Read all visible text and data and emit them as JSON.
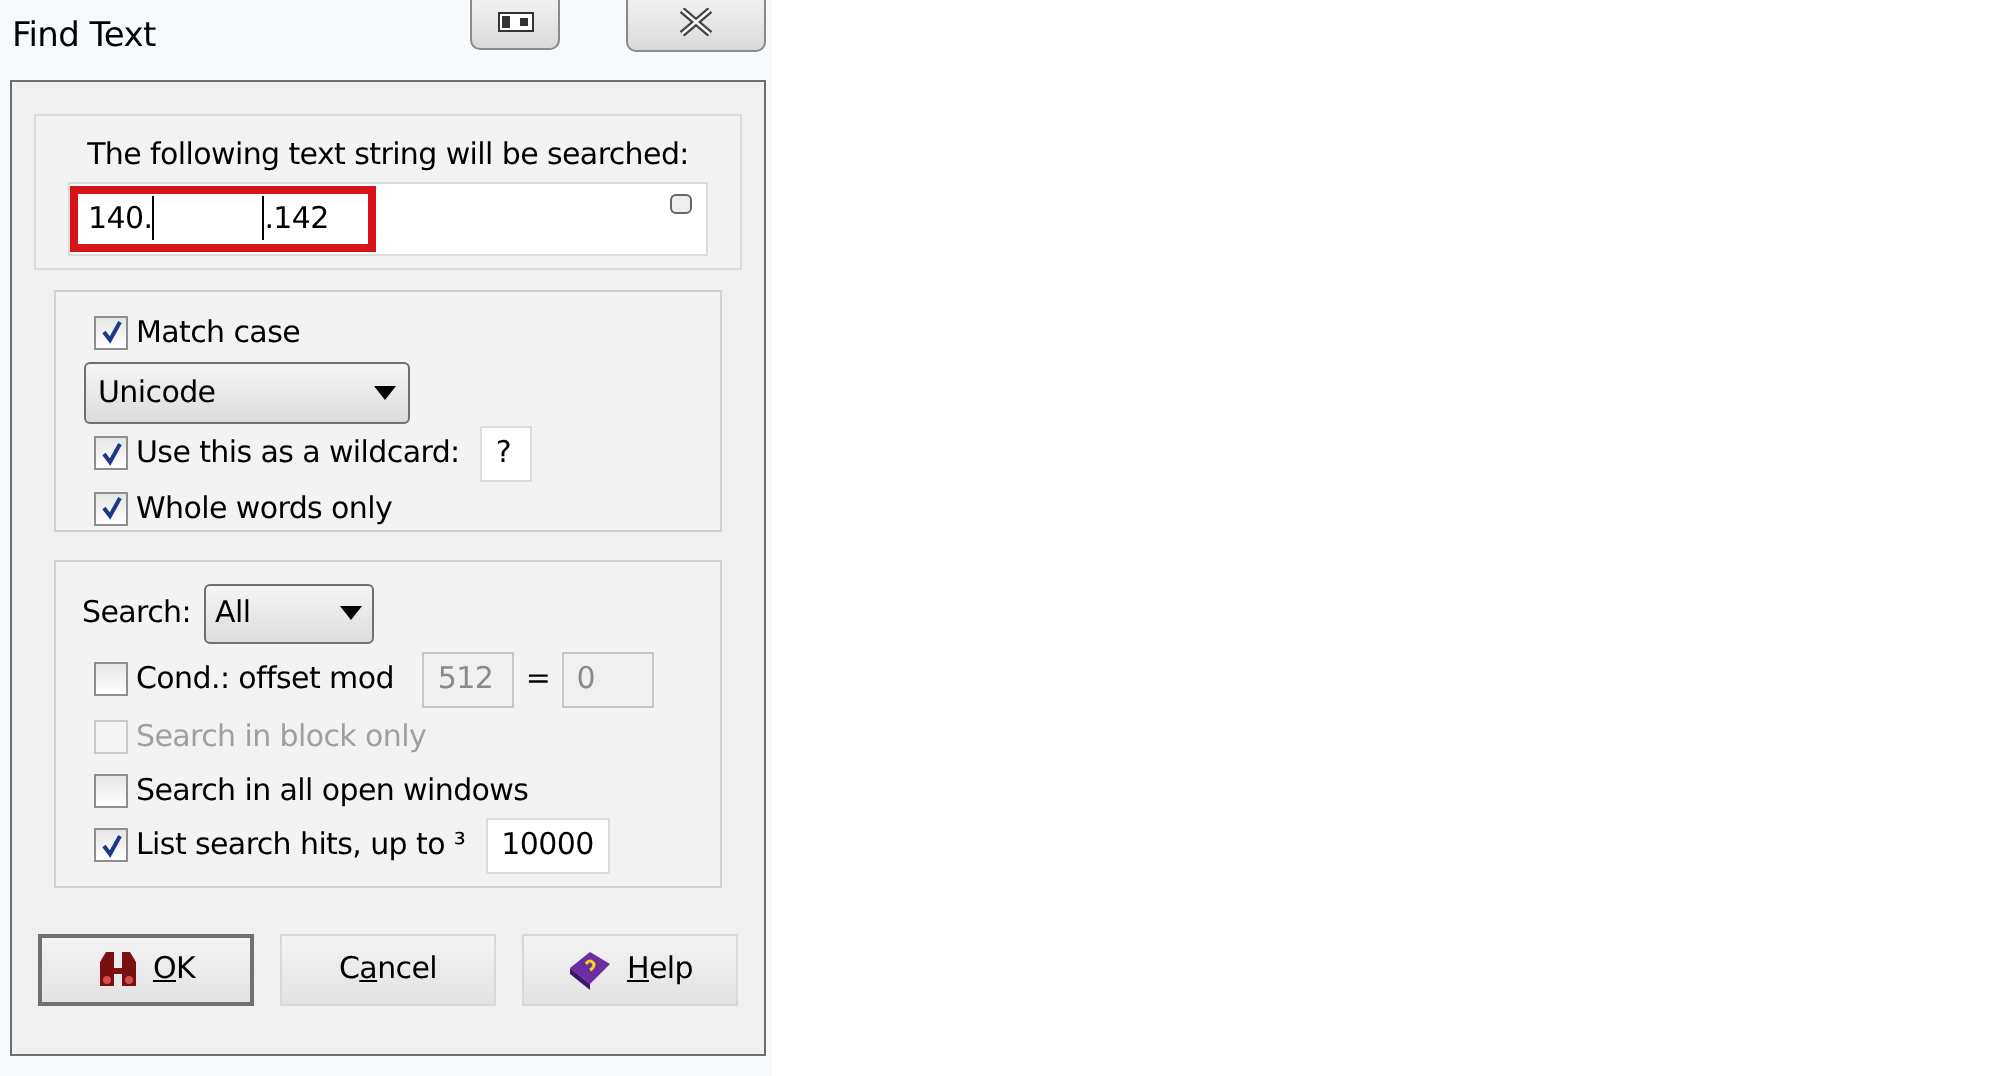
{
  "window": {
    "title": "Find Text"
  },
  "search_string": {
    "label": "The following text string will be searched:",
    "value_start": "140.",
    "value_end": ".142",
    "redacted": true,
    "highlighted": true
  },
  "options": [
    {
      "kind": "checkbox",
      "label": "Match case",
      "checked": true,
      "disabled": false
    },
    {
      "kind": "dropdown",
      "value": "Unicode"
    },
    {
      "kind": "checkbox_field",
      "label": "Use this as a wildcard:",
      "checked": true,
      "disabled": false,
      "value": "?"
    },
    {
      "kind": "checkbox",
      "label": "Whole words only",
      "checked": true,
      "disabled": false
    }
  ],
  "search_options": [
    {
      "kind": "labeled_dropdown",
      "label": "Search:",
      "value": "All"
    },
    {
      "kind": "checkbox_mod",
      "label": "Cond.: offset mod",
      "checked": false,
      "disabled": false,
      "value": "512",
      "equals": "=",
      "value2": "0",
      "fields_disabled": true
    },
    {
      "kind": "checkbox",
      "label": "Search in block only",
      "checked": false,
      "disabled": true
    },
    {
      "kind": "checkbox",
      "label": "Search in all open windows",
      "checked": false,
      "disabled": false
    },
    {
      "kind": "checkbox_field",
      "label": "List search hits, up to ³",
      "checked": true,
      "disabled": false,
      "value": "10000"
    }
  ],
  "buttons": [
    {
      "kind": "ok",
      "accel": "O",
      "after": "K",
      "default": true
    },
    {
      "kind": "cancel",
      "before": "C",
      "accel": "a",
      "after": "ncel",
      "default": false
    },
    {
      "kind": "help",
      "accel": "H",
      "after": "elp",
      "default": false
    }
  ]
}
